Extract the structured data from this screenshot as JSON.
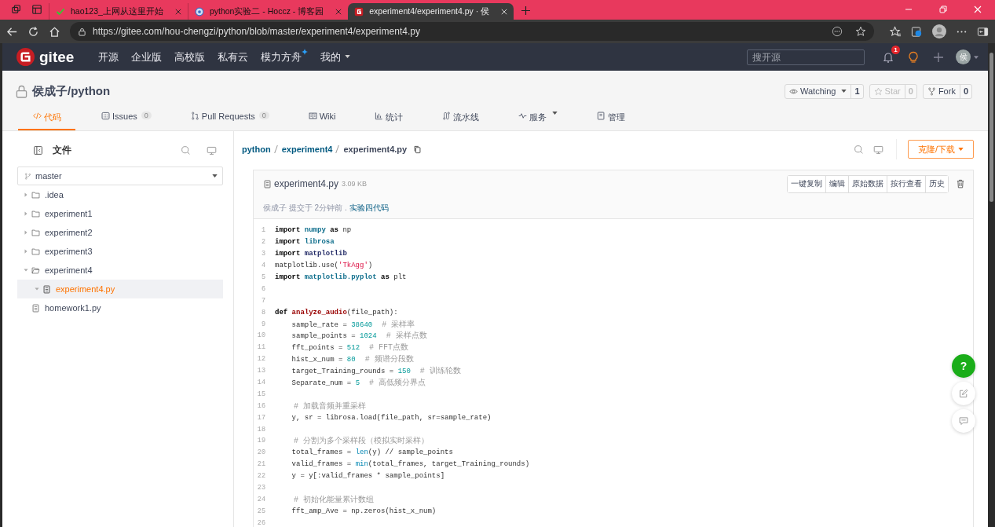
{
  "browser": {
    "tabs": [
      {
        "kind": "hao",
        "title": "hao123_上网从这里开始",
        "selected": false
      },
      {
        "kind": "blog",
        "title": "python实验二 - Hoccz - 博客园",
        "selected": false
      },
      {
        "kind": "gitee",
        "title": "experiment4/experiment4.py · 侯",
        "selected": true
      }
    ],
    "url": "https://gitee.com/hou-chengzi/python/blob/master/experiment4/experiment4.py"
  },
  "site_header": {
    "brand": "gitee",
    "nav": [
      {
        "label": "开源",
        "kind": "plain"
      },
      {
        "label": "企业版",
        "kind": "plain"
      },
      {
        "label": "高校版",
        "kind": "plain"
      },
      {
        "label": "私有云",
        "kind": "plain"
      },
      {
        "label": "模力方舟",
        "kind": "sparkle"
      },
      {
        "label": "我的",
        "kind": "dropdown"
      }
    ],
    "search": {
      "placeholder": "搜开源"
    },
    "notification_count": "1",
    "avatar": "侯"
  },
  "repo": {
    "title": "侯成子/python",
    "actions": [
      {
        "label": "Watching",
        "count": "1",
        "kind": "watch",
        "disabled": false
      },
      {
        "label": "Star",
        "count": "0",
        "kind": "star",
        "disabled": true
      },
      {
        "label": "Fork",
        "count": "0",
        "kind": "fork",
        "disabled": false
      }
    ],
    "tabs": [
      {
        "label": "代码",
        "kind": "code",
        "selected": true
      },
      {
        "label": "Issues",
        "kind": "issues",
        "count": "0",
        "selected": false
      },
      {
        "label": "Pull Requests",
        "kind": "pr",
        "count": "0",
        "selected": false
      },
      {
        "label": "Wiki",
        "kind": "wiki",
        "selected": false
      },
      {
        "label": "统计",
        "kind": "stats",
        "selected": false
      },
      {
        "label": "流水线",
        "kind": "pipeline",
        "selected": false
      },
      {
        "label": "服务",
        "kind": "service",
        "selected": false
      },
      {
        "label": "管理",
        "kind": "manage",
        "selected": false
      }
    ]
  },
  "sidebar": {
    "title": "文件",
    "branch": "master",
    "tree": [
      {
        "name": ".idea",
        "kind": "folder",
        "expanded": false,
        "selected": false
      },
      {
        "name": "experiment1",
        "kind": "folder",
        "expanded": false,
        "selected": false
      },
      {
        "name": "experiment2",
        "kind": "folder",
        "expanded": false,
        "selected": false
      },
      {
        "name": "experiment3",
        "kind": "folder",
        "expanded": false,
        "selected": false
      },
      {
        "name": "experiment4",
        "kind": "folder",
        "expanded": true,
        "selected": false,
        "children": [
          {
            "name": "experiment4.py",
            "kind": "file",
            "selected": true
          }
        ]
      },
      {
        "name": "homework1.py",
        "kind": "file",
        "selected": false
      }
    ]
  },
  "breadcrumb": [
    "python",
    "experiment4",
    "experiment4.py"
  ],
  "clone_button": "克隆/下载",
  "file": {
    "name": "experiment4.py",
    "size": "3.09 KB",
    "actions": [
      "一键复制",
      "编辑",
      "原始数据",
      "按行查看",
      "历史"
    ],
    "commit": {
      "text": "侯成子 提交于 2分钟前 .",
      "message": "实验四代码"
    },
    "lines": [
      {
        "number": "1",
        "tokens": [
          {
            "kind": "kw",
            "text": "import"
          },
          {
            "kind": "mod",
            "text": " numpy"
          },
          {
            "kind": "kw",
            "text": " as"
          },
          {
            "kind": "p",
            "text": " np"
          }
        ]
      },
      {
        "number": "2",
        "tokens": [
          {
            "kind": "kw",
            "text": "import"
          },
          {
            "kind": "mod",
            "text": " librosa"
          }
        ]
      },
      {
        "number": "3",
        "tokens": [
          {
            "kind": "kw",
            "text": "import"
          },
          {
            "kind": "cls",
            "text": " matplotlib"
          }
        ]
      },
      {
        "number": "4",
        "tokens": [
          {
            "kind": "p",
            "text": "matplotlib.use("
          },
          {
            "kind": "str",
            "text": "'TkAgg'"
          },
          {
            "kind": "p",
            "text": ")"
          }
        ]
      },
      {
        "number": "5",
        "tokens": [
          {
            "kind": "kw",
            "text": "import"
          },
          {
            "kind": "mod",
            "text": " matplotlib.pyplot"
          },
          {
            "kind": "kw",
            "text": " as"
          },
          {
            "kind": "p",
            "text": " plt"
          }
        ]
      },
      {
        "number": "6"
      },
      {
        "number": "7"
      },
      {
        "number": "8",
        "tokens": [
          {
            "kind": "kw",
            "text": "def"
          },
          {
            "kind": "fn",
            "text": " analyze_audio"
          },
          {
            "kind": "p",
            "text": "(file_path):"
          }
        ]
      },
      {
        "number": "9",
        "tokens": [
          {
            "kind": "p",
            "text": "    sample_rate = "
          },
          {
            "kind": "num",
            "text": "38640"
          },
          {
            "kind": "cm",
            "text": "  # 采样率"
          }
        ]
      },
      {
        "number": "10",
        "tokens": [
          {
            "kind": "p",
            "text": "    sample_points = "
          },
          {
            "kind": "num",
            "text": "1024"
          },
          {
            "kind": "cm",
            "text": "  # 采样点数"
          }
        ]
      },
      {
        "number": "11",
        "tokens": [
          {
            "kind": "p",
            "text": "    fft_points = "
          },
          {
            "kind": "num",
            "text": "512"
          },
          {
            "kind": "cm",
            "text": "  # FFT点数"
          }
        ]
      },
      {
        "number": "12",
        "tokens": [
          {
            "kind": "p",
            "text": "    hist_x_num = "
          },
          {
            "kind": "num",
            "text": "80"
          },
          {
            "kind": "cm",
            "text": "  # 频谱分段数"
          }
        ]
      },
      {
        "number": "13",
        "tokens": [
          {
            "kind": "p",
            "text": "    target_Training_rounds = "
          },
          {
            "kind": "num",
            "text": "150"
          },
          {
            "kind": "cm",
            "text": "  # 训练轮数"
          }
        ]
      },
      {
        "number": "14",
        "tokens": [
          {
            "kind": "p",
            "text": "    Separate_num = "
          },
          {
            "kind": "num",
            "text": "5"
          },
          {
            "kind": "cm",
            "text": "  # 高低频分界点"
          }
        ]
      },
      {
        "number": "15"
      },
      {
        "number": "16",
        "tokens": [
          {
            "kind": "cm",
            "text": "    # 加载音频并重采样"
          }
        ]
      },
      {
        "number": "17",
        "tokens": [
          {
            "kind": "p",
            "text": "    y, sr = librosa.load(file_path, sr=sample_rate)"
          }
        ]
      },
      {
        "number": "18"
      },
      {
        "number": "19",
        "tokens": [
          {
            "kind": "cm",
            "text": "    # 分割为多个采样段（模拟实时采样）"
          }
        ]
      },
      {
        "number": "20",
        "tokens": [
          {
            "kind": "p",
            "text": "    total_frames = "
          },
          {
            "kind": "bi",
            "text": "len"
          },
          {
            "kind": "p",
            "text": "(y) // sample_points"
          }
        ]
      },
      {
        "number": "21",
        "tokens": [
          {
            "kind": "p",
            "text": "    valid_frames = "
          },
          {
            "kind": "bi",
            "text": "min"
          },
          {
            "kind": "p",
            "text": "(total_frames, target_Training_rounds)"
          }
        ]
      },
      {
        "number": "22",
        "tokens": [
          {
            "kind": "p",
            "text": "    y = y[:valid_frames * sample_points]"
          }
        ]
      },
      {
        "number": "23"
      },
      {
        "number": "24",
        "tokens": [
          {
            "kind": "cm",
            "text": "    # 初始化能量累计数组"
          }
        ]
      },
      {
        "number": "25",
        "tokens": [
          {
            "kind": "p",
            "text": "    fft_amp_Ave = np.zeros(hist_x_num)"
          }
        ]
      },
      {
        "number": "26"
      }
    ]
  },
  "floating_buttons": [
    {
      "kind": "help",
      "label": "?"
    },
    {
      "kind": "edit"
    },
    {
      "kind": "comment"
    }
  ]
}
